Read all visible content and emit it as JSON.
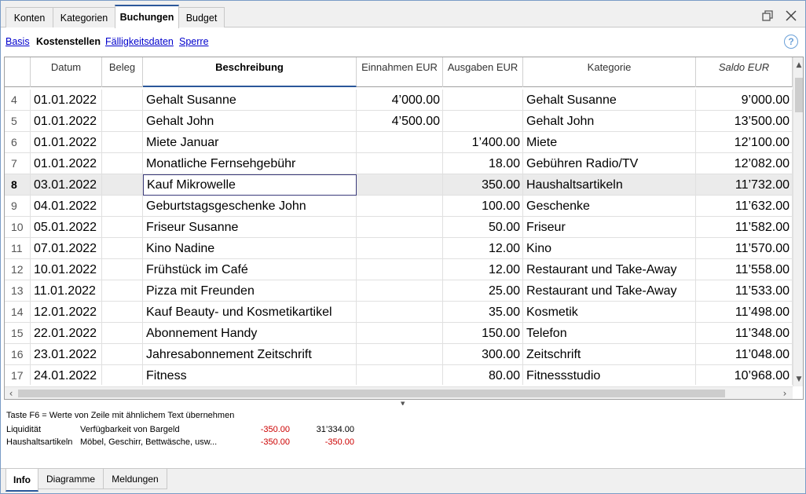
{
  "top_tabs": [
    "Konten",
    "Kategorien",
    "Buchungen",
    "Budget"
  ],
  "active_top_tab": "Buchungen",
  "window_icons": [
    "restore-icon",
    "close-icon"
  ],
  "subnav": {
    "links": [
      "Basis",
      "Kostenstellen",
      "Fälligkeitsdaten",
      "Sperre"
    ],
    "active": "Kostenstellen",
    "help": "?"
  },
  "table": {
    "columns": [
      "",
      "Datum",
      "Beleg",
      "Beschreibung",
      "Einnahmen EUR",
      "Ausgaben EUR",
      "Kategorie",
      "Saldo EUR"
    ],
    "sorted_column": "Beschreibung",
    "rows": [
      {
        "nr": "4",
        "datum": "01.01.2022",
        "beleg": "",
        "beschreibung": "Gehalt Susanne",
        "einnahmen": "4’000.00",
        "ausgaben": "",
        "kategorie": "Gehalt Susanne",
        "saldo": "9’000.00"
      },
      {
        "nr": "5",
        "datum": "01.01.2022",
        "beleg": "",
        "beschreibung": "Gehalt John",
        "einnahmen": "4’500.00",
        "ausgaben": "",
        "kategorie": "Gehalt John",
        "saldo": "13’500.00"
      },
      {
        "nr": "6",
        "datum": "01.01.2022",
        "beleg": "",
        "beschreibung": "Miete Januar",
        "einnahmen": "",
        "ausgaben": "1’400.00",
        "kategorie": "Miete",
        "saldo": "12’100.00"
      },
      {
        "nr": "7",
        "datum": "01.01.2022",
        "beleg": "",
        "beschreibung": "Monatliche Fernsehgebühr",
        "einnahmen": "",
        "ausgaben": "18.00",
        "kategorie": "Gebühren Radio/TV",
        "saldo": "12’082.00"
      },
      {
        "nr": "8",
        "datum": "03.01.2022",
        "beleg": "",
        "beschreibung": "Kauf Mikrowelle",
        "einnahmen": "",
        "ausgaben": "350.00",
        "kategorie": "Haushaltsartikeln",
        "saldo": "11’732.00"
      },
      {
        "nr": "9",
        "datum": "04.01.2022",
        "beleg": "",
        "beschreibung": "Geburtstagsgeschenke John",
        "einnahmen": "",
        "ausgaben": "100.00",
        "kategorie": "Geschenke",
        "saldo": "11’632.00"
      },
      {
        "nr": "10",
        "datum": "05.01.2022",
        "beleg": "",
        "beschreibung": "Friseur Susanne",
        "einnahmen": "",
        "ausgaben": "50.00",
        "kategorie": "Friseur",
        "saldo": "11’582.00"
      },
      {
        "nr": "11",
        "datum": "07.01.2022",
        "beleg": "",
        "beschreibung": "Kino Nadine",
        "einnahmen": "",
        "ausgaben": "12.00",
        "kategorie": "Kino",
        "saldo": "11’570.00"
      },
      {
        "nr": "12",
        "datum": "10.01.2022",
        "beleg": "",
        "beschreibung": "Frühstück im Café",
        "einnahmen": "",
        "ausgaben": "12.00",
        "kategorie": "Restaurant und Take-Away",
        "saldo": "11’558.00"
      },
      {
        "nr": "13",
        "datum": "11.01.2022",
        "beleg": "",
        "beschreibung": "Pizza mit Freunden",
        "einnahmen": "",
        "ausgaben": "25.00",
        "kategorie": "Restaurant und Take-Away",
        "saldo": "11’533.00"
      },
      {
        "nr": "14",
        "datum": "12.01.2022",
        "beleg": "",
        "beschreibung": "Kauf Beauty- und Kosmetikartikel",
        "einnahmen": "",
        "ausgaben": "35.00",
        "kategorie": "Kosmetik",
        "saldo": "11’498.00"
      },
      {
        "nr": "15",
        "datum": "22.01.2022",
        "beleg": "",
        "beschreibung": "Abonnement Handy",
        "einnahmen": "",
        "ausgaben": "150.00",
        "kategorie": "Telefon",
        "saldo": "11’348.00"
      },
      {
        "nr": "16",
        "datum": "23.01.2022",
        "beleg": "",
        "beschreibung": "Jahresabonnement Zeitschrift",
        "einnahmen": "",
        "ausgaben": "300.00",
        "kategorie": "Zeitschrift",
        "saldo": "11’048.00"
      },
      {
        "nr": "17",
        "datum": "24.01.2022",
        "beleg": "",
        "beschreibung": "Fitness",
        "einnahmen": "",
        "ausgaben": "80.00",
        "kategorie": "Fitnessstudio",
        "saldo": "10’968.00"
      }
    ],
    "selected_row": "8",
    "focused_column": "beschreibung"
  },
  "info": {
    "hint": "Taste F6 = Werte von Zeile mit ähnlichem Text übernehmen",
    "lines": [
      {
        "label": "Liquidität",
        "desc": "Verfügbarkeit von Bargeld",
        "amount": "-350.00",
        "balance": "31’334.00",
        "balance_negative": false
      },
      {
        "label": "Haushaltsartikeln",
        "desc": "Möbel, Geschirr, Bettwäsche, usw...",
        "amount": "-350.00",
        "balance": "-350.00",
        "balance_negative": true
      }
    ]
  },
  "bottom_tabs": [
    "Info",
    "Diagramme",
    "Meldungen"
  ],
  "active_bottom_tab": "Info",
  "colors": {
    "accent": "#2b579a",
    "link": "#0000cc",
    "negative": "#cc0000",
    "selected_row": "#ebebeb"
  }
}
